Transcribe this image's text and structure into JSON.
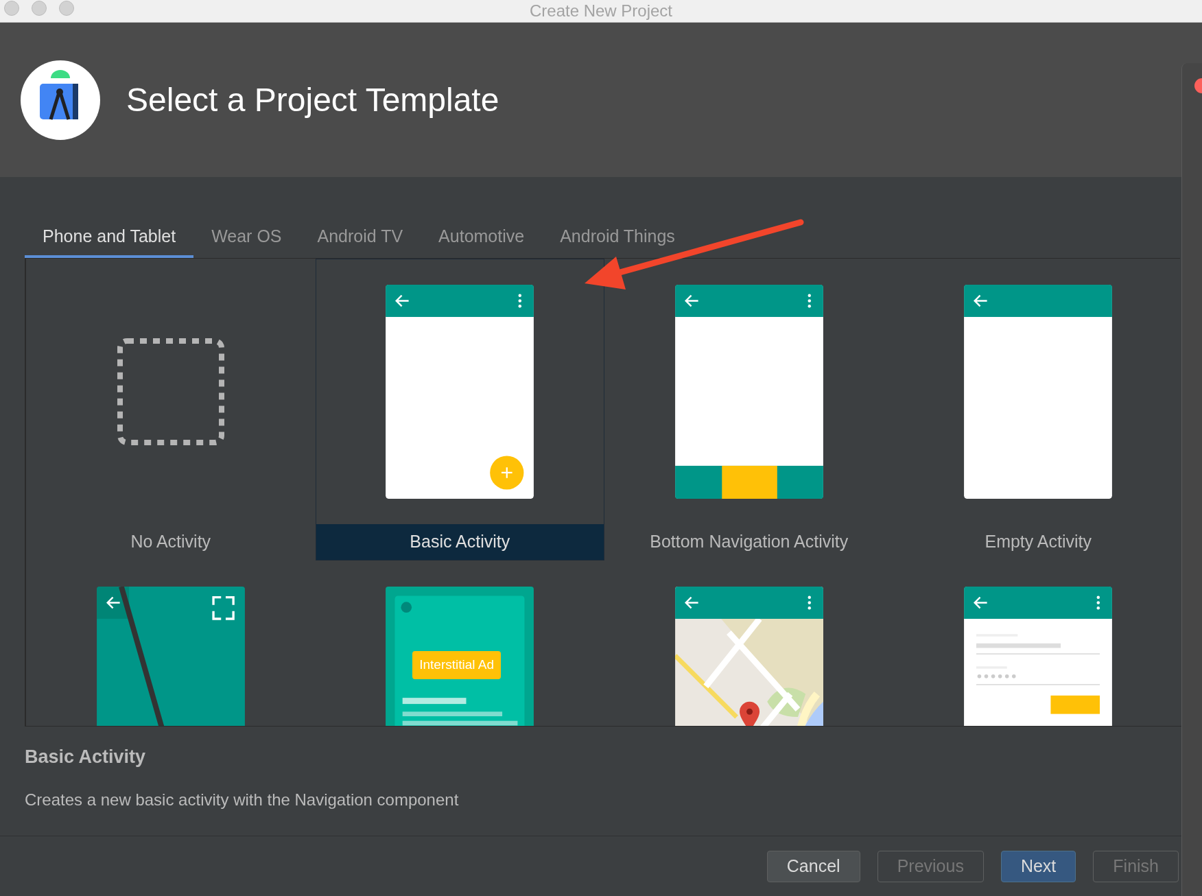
{
  "window": {
    "title": "Create New Project"
  },
  "header": {
    "title": "Select a Project Template"
  },
  "tabs": [
    {
      "label": "Phone and Tablet",
      "selected": true
    },
    {
      "label": "Wear OS",
      "selected": false
    },
    {
      "label": "Android TV",
      "selected": false
    },
    {
      "label": "Automotive",
      "selected": false
    },
    {
      "label": "Android Things",
      "selected": false
    }
  ],
  "templates": [
    {
      "kind": "none",
      "label": "No Activity",
      "selected": false
    },
    {
      "kind": "basic",
      "label": "Basic Activity",
      "selected": true
    },
    {
      "kind": "bottom_nav",
      "label": "Bottom Navigation Activity",
      "selected": false
    },
    {
      "kind": "empty",
      "label": "Empty Activity",
      "selected": false
    },
    {
      "kind": "fullscreen",
      "selected": false
    },
    {
      "kind": "ad",
      "badge": "Interstitial Ad",
      "selected": false
    },
    {
      "kind": "maps",
      "selected": false
    },
    {
      "kind": "login",
      "selected": false
    }
  ],
  "description": {
    "title": "Basic Activity",
    "text": "Creates a new basic activity with the Navigation component"
  },
  "buttons": [
    {
      "label": "Cancel",
      "disabled": false,
      "primary": false
    },
    {
      "label": "Previous",
      "disabled": true,
      "primary": false
    },
    {
      "label": "Next",
      "disabled": false,
      "primary": true
    },
    {
      "label": "Finish",
      "disabled": true,
      "primary": false
    }
  ]
}
